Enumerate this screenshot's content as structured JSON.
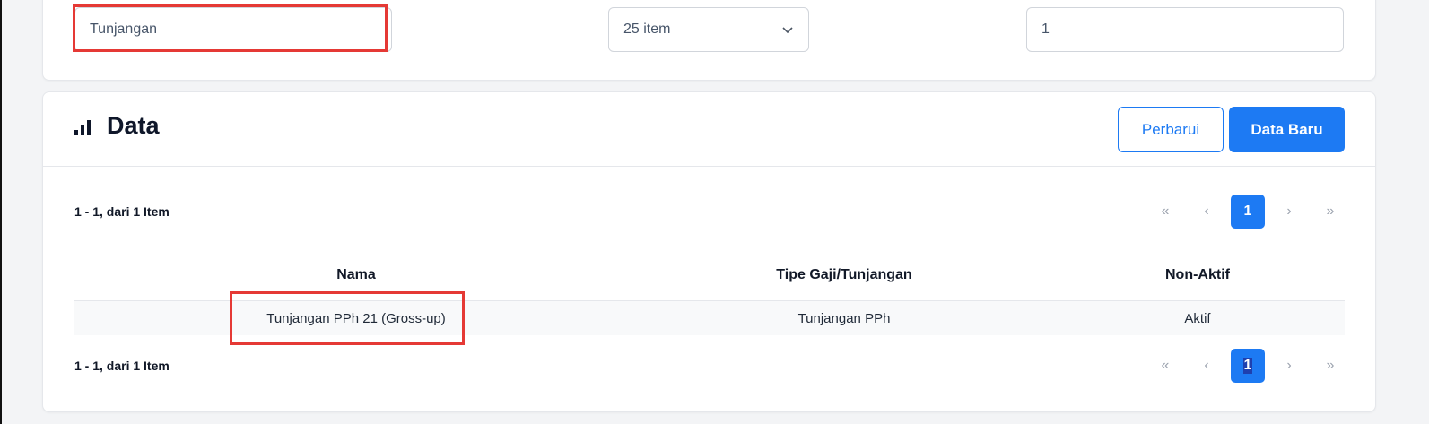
{
  "filters": {
    "name_value": "Tunjangan",
    "page_size_value": "25 item",
    "page_number_value": "1"
  },
  "data_panel": {
    "title": "Data",
    "refresh_label": "Perbarui",
    "new_label": "Data Baru"
  },
  "pagination": {
    "summary": "1 - 1, dari 1 Item",
    "first": "«",
    "prev": "‹",
    "current": "1",
    "next": "›",
    "last": "»"
  },
  "table": {
    "headers": [
      "Nama",
      "Tipe Gaji/Tunjangan",
      "Non-Aktif"
    ],
    "rows": [
      [
        "Tunjangan PPh 21 (Gross-up)",
        "Tunjangan PPh",
        "Aktif"
      ]
    ]
  },
  "colors": {
    "primary": "#1d7af3",
    "highlight": "#e53935"
  }
}
